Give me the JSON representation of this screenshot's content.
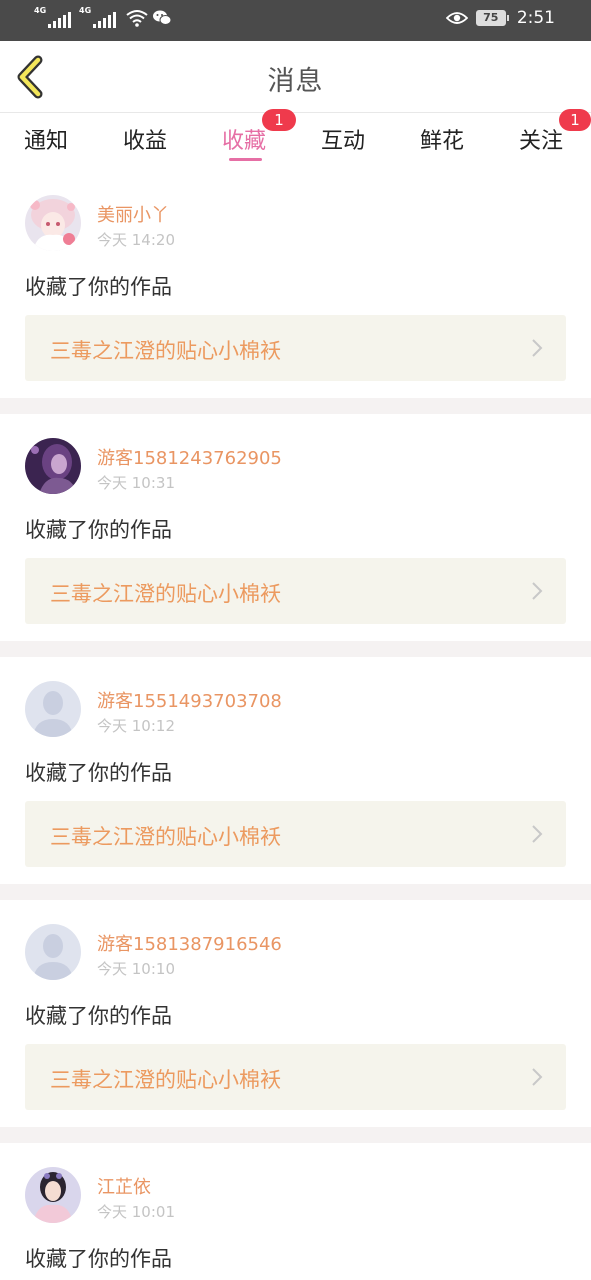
{
  "status_bar": {
    "sim1_tag": "4G",
    "sim2_tag": "4G",
    "battery": "75",
    "time": "2:51"
  },
  "header": {
    "title": "消息"
  },
  "tabs": [
    {
      "label": "通知",
      "active": false,
      "badge": ""
    },
    {
      "label": "收益",
      "active": false,
      "badge": ""
    },
    {
      "label": "收藏",
      "active": true,
      "badge": "1"
    },
    {
      "label": "互动",
      "active": false,
      "badge": ""
    },
    {
      "label": "鲜花",
      "active": false,
      "badge": ""
    },
    {
      "label": "关注",
      "active": false,
      "badge": "1"
    }
  ],
  "feed": [
    {
      "name": "美丽小丫",
      "time": "今天 14:20",
      "action": "收藏了你的作品",
      "work": "三毒之江澄的贴心小棉袄",
      "avatar": "anime-girl-avatar"
    },
    {
      "name": "游客1581243762905",
      "time": "今天 10:31",
      "action": "收藏了你的作品",
      "work": "三毒之江澄的贴心小棉袄",
      "avatar": "purple-photo-avatar"
    },
    {
      "name": "游客1551493703708",
      "time": "今天 10:12",
      "action": "收藏了你的作品",
      "work": "三毒之江澄的贴心小棉袄",
      "avatar": "default-user-avatar"
    },
    {
      "name": "游客1581387916546",
      "time": "今天 10:10",
      "action": "收藏了你的作品",
      "work": "三毒之江澄的贴心小棉袄",
      "avatar": "default-user-avatar"
    },
    {
      "name": "江芷依",
      "time": "今天 10:01",
      "action": "收藏了你的作品",
      "work": "",
      "avatar": "costume-photo-avatar"
    }
  ],
  "colors": {
    "accent_pink": "#e66fa5",
    "username_orange": "#e99563",
    "work_title_orange": "#ec9a5f",
    "badge_red": "#ef3a4c",
    "back_yellow": "#f3e65a"
  }
}
